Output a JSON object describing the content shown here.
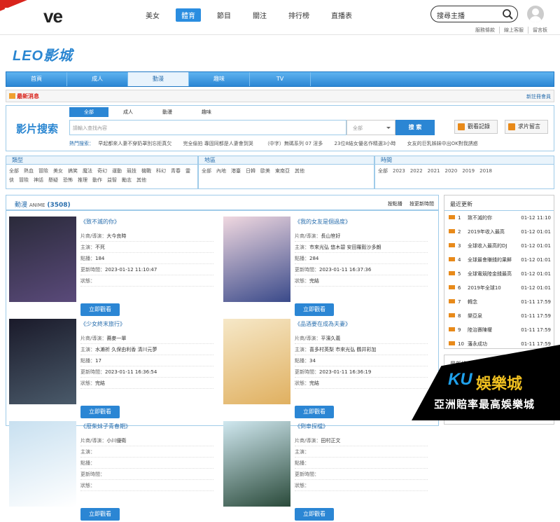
{
  "topbar": {
    "new_badge": "NEW",
    "logo_partial": "ve",
    "nav": [
      "美女",
      "體育",
      "節目",
      "關注",
      "排行榜",
      "直播表"
    ],
    "nav_active": 1,
    "search_placeholder": "搜尋主播",
    "links": [
      "服務條款",
      "線上客服",
      "留言板"
    ]
  },
  "site_logo": "LEO影城",
  "mainnav": [
    "首頁",
    "成人",
    "動漫",
    "趣味",
    "TV"
  ],
  "mainnav_active": 2,
  "newsbar": {
    "label": "最新消息",
    "register": "新註冊會員"
  },
  "search": {
    "title": "影片搜索",
    "tabs": [
      "全部",
      "成人",
      "動漫",
      "趣味"
    ],
    "placeholder": "請輸入查找內容",
    "select": "全部",
    "button": "搜 索",
    "history": "觀看記錄",
    "request": "求片留言",
    "hot_label": "熱門搜索：",
    "hot": [
      "早起都來人妻不穿奶罩別忘拒真欠",
      "完全偷拍 專固同都是人妻會到哭",
      "（中字）無碼系列 07 淫多",
      "23位8結女優名作精選3小時",
      "女友的巨乳姊妹中出OK對我誘惑"
    ]
  },
  "filters": {
    "type": {
      "label": "類型",
      "items": [
        "全部",
        "熱血",
        "冒險",
        "美女",
        "搞笑",
        "魔法",
        "奇幻",
        "運動",
        "競技",
        "機戰",
        "科幻",
        "青春",
        "靈俠",
        "冒險",
        "神話",
        "懸疑",
        "恐怖",
        "推理",
        "動作",
        "益智",
        "勵志",
        "其他"
      ]
    },
    "region": {
      "label": "地區",
      "items": [
        "全部",
        "內地",
        "港臺",
        "日韓",
        "歐美",
        "東南亞",
        "其他"
      ]
    },
    "year": {
      "label": "時間",
      "items": [
        "全部",
        "2023",
        "2022",
        "2021",
        "2020",
        "2019",
        "2018"
      ]
    }
  },
  "list": {
    "title": "動漫",
    "subtitle": "ANIME",
    "count": "(3508)",
    "sorts": [
      "按點播",
      "按更新時間"
    ],
    "labels": {
      "director": "片商/導演：",
      "cast": "主演：",
      "hits": "點播：",
      "updated": "更新時間：",
      "status": "狀態：",
      "watch": "立即觀看"
    },
    "items": [
      {
        "title": "《致不滅的你》",
        "director": "大今良時",
        "cast": "不死",
        "hits": "184",
        "updated": "2023-01-12 11:10:47",
        "status": ""
      },
      {
        "title": "《我的女友是個過度》",
        "director": "長山笹好",
        "cast": "市來光弘 悠木碧 安田羅毅沙多朗",
        "hits": "284",
        "updated": "2023-01-11 16:37:36",
        "status": "完結"
      },
      {
        "title": "《少女終末旅行》",
        "director": "蕎麥一單",
        "cast": "水瀨祈 久保由利香 清川元夢",
        "hits": "17",
        "updated": "2023-01-11 16:36:54",
        "status": "完結"
      },
      {
        "title": "《品酒要在成為夫妻》",
        "director": "平濱久義",
        "cast": "喜多村英梨 市來光弘 鶴井彩加",
        "hits": "34",
        "updated": "2023-01-11 16:36:19",
        "status": "完結"
      },
      {
        "title": "《廢柴妹子青春期》",
        "director": "小川優衛",
        "cast": "",
        "hits": "",
        "updated": "",
        "status": ""
      },
      {
        "title": "《倒車探檔》",
        "director": "田村正文",
        "cast": "",
        "hits": "",
        "updated": "",
        "status": ""
      }
    ]
  },
  "recent": {
    "title": "最近更新",
    "items": [
      {
        "n": "1",
        "t": "致不滅的你",
        "d": "01-12 11:10"
      },
      {
        "n": "2",
        "t": "2019年收入最高",
        "d": "01-12 01:01"
      },
      {
        "n": "3",
        "t": "全球收入最高的DJ",
        "d": "01-12 01:01"
      },
      {
        "n": "4",
        "t": "全球最會賺錢的果鮮",
        "d": "01-12 01:01"
      },
      {
        "n": "5",
        "t": "全球電競陸金錢最高",
        "d": "01-12 01:01"
      },
      {
        "n": "6",
        "t": "2019年全球10",
        "d": "01-12 01:01"
      },
      {
        "n": "7",
        "t": "轉念",
        "d": "01-11 17:59"
      },
      {
        "n": "8",
        "t": "樂亞泉",
        "d": "01-11 17:59"
      },
      {
        "n": "9",
        "t": "陸治賽陳權",
        "d": "01-11 17:59"
      },
      {
        "n": "10",
        "t": "藩永成功",
        "d": "01-11 17:59"
      }
    ]
  },
  "ranking": {
    "title": "最新排名"
  },
  "ad": {
    "ku": "KU",
    "brand": "娛樂城",
    "slogan": "亞洲賠率最高娛樂城"
  },
  "colors": {
    "accent": "#2b86d4",
    "red": "#d9241c",
    "gold": "#f0c020"
  }
}
